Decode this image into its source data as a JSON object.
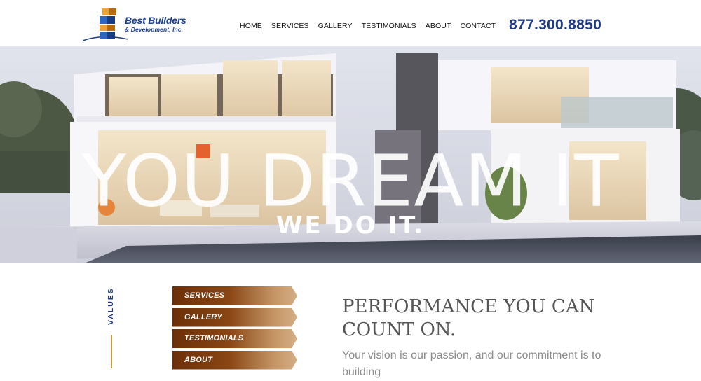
{
  "brand": {
    "name_line1": "Best Builders",
    "name_line2": "& Development, Inc.",
    "logo_icon": "building-blocks-logo"
  },
  "nav": {
    "items": [
      "HOME",
      "SERVICES",
      "GALLERY",
      "TESTIMONIALS",
      "ABOUT",
      "CONTACT"
    ],
    "active": "HOME"
  },
  "phone": "877.300.8850",
  "hero": {
    "title": "YOU DREAM IT",
    "subtitle": "WE DO IT."
  },
  "values_label": "VALUES",
  "side_menu": [
    "SERVICES",
    "GALLERY",
    "TESTIMONIALS",
    "ABOUT"
  ],
  "performance": {
    "title": "PERFORMANCE YOU CAN COUNT ON.",
    "text": "Your vision is our passion, and our commitment is to building"
  },
  "colors": {
    "brand_blue": "#1e3a86",
    "logo_gold": "#e8a23a",
    "menu_brown": "#7a3a0e",
    "accent_gold": "#c89b3c"
  }
}
